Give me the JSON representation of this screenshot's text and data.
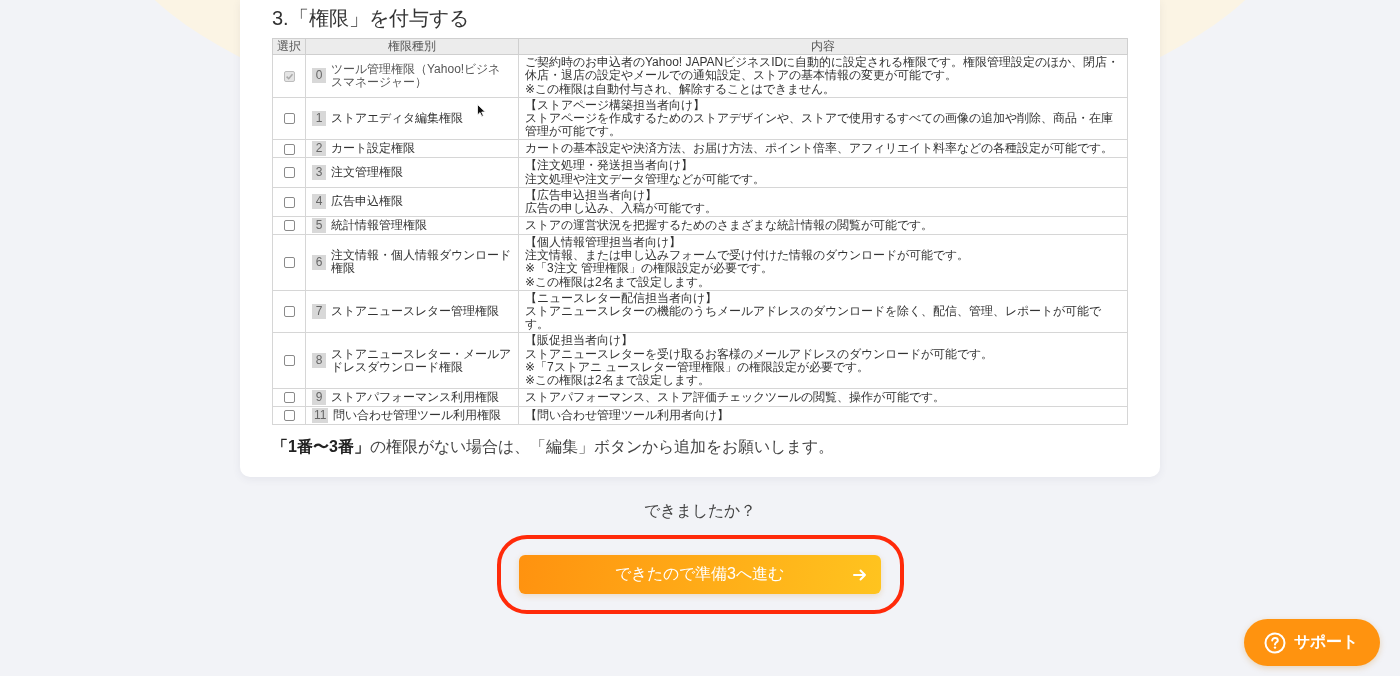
{
  "step_heading": "3.「権限」を付与する",
  "permission_table": {
    "columns": [
      "選択",
      "権限種別",
      "内容"
    ],
    "rows": [
      {
        "checked": true,
        "disabled": true,
        "number": "0",
        "name": "ツール管理権限（Yahoo!ビジネスマネージャー）",
        "description": [
          "ご契約時のお申込者のYahoo! JAPANビジネスIDに自動的に設定される権限です。権限管理設定のほか、閉店・休店・退店の設定やメールでの通知設定、ストアの基本情報の変更が可能です。",
          "※この権限は自動付与され、解除することはできません。"
        ]
      },
      {
        "checked": false,
        "disabled": false,
        "number": "1",
        "name": "ストアエディタ編集権限",
        "description": [
          "【ストアページ構築担当者向け】",
          "ストアページを作成するためのストアデザインや、ストアで使用するすべての画像の追加や削除、商品・在庫管理が可能です。"
        ]
      },
      {
        "checked": false,
        "disabled": false,
        "number": "2",
        "name": "カート設定権限",
        "description": [
          "カートの基本設定や決済方法、お届け方法、ポイント倍率、アフィリエイト料率などの各種設定が可能です。"
        ]
      },
      {
        "checked": false,
        "disabled": false,
        "number": "3",
        "name": "注文管理権限",
        "description": [
          "【注文処理・発送担当者向け】",
          "注文処理や注文データ管理などが可能です。"
        ]
      },
      {
        "checked": false,
        "disabled": false,
        "number": "4",
        "name": "広告申込権限",
        "description": [
          "【広告申込担当者向け】",
          "広告の申し込み、入稿が可能です。"
        ]
      },
      {
        "checked": false,
        "disabled": false,
        "number": "5",
        "name": "統計情報管理権限",
        "description": [
          "ストアの運営状況を把握するためのさまざまな統計情報の閲覧が可能です。"
        ]
      },
      {
        "checked": false,
        "disabled": false,
        "number": "6",
        "name": "注文情報・個人情報ダウンロード権限",
        "description": [
          "【個人情報管理担当者向け】",
          "注文情報、または申し込みフォームで受け付けた情報のダウンロードが可能です。",
          "※「3注文 管理権限」の権限設定が必要です。",
          "※この権限は2名まで設定します。"
        ]
      },
      {
        "checked": false,
        "disabled": false,
        "number": "7",
        "name": "ストアニュースレター管理権限",
        "description": [
          "【ニュースレター配信担当者向け】",
          "ストアニュースレターの機能のうちメールアドレスのダウンロードを除く、配信、管理、レポートが可能です。"
        ]
      },
      {
        "checked": false,
        "disabled": false,
        "number": "8",
        "name": "ストアニュースレター・メールアドレスダウンロード権限",
        "description": [
          "【販促担当者向け】",
          "ストアニュースレターを受け取るお客様のメールアドレスのダウンロードが可能です。",
          "※「7ストアニ ュースレター管理権限」の権限設定が必要です。",
          "※この権限は2名まで設定します。"
        ]
      },
      {
        "checked": false,
        "disabled": false,
        "number": "9",
        "name": "ストアパフォーマンス利用権限",
        "description": [
          "ストアパフォーマンス、ストア評価チェックツールの閲覧、操作が可能です。"
        ]
      },
      {
        "checked": false,
        "disabled": false,
        "number": "11",
        "name": "問い合わせ管理ツール利用権限",
        "description": [
          "【問い合わせ管理ツール利用者向け】"
        ]
      }
    ]
  },
  "note": "**「1番〜3番」**の権限がない場合は、「編集」ボタンから追加をお願いします。",
  "question": "できましたか？",
  "next_button": {
    "label": "できたので準備3へ進む",
    "highlighted": true
  },
  "support_button": {
    "label": "サポート"
  }
}
